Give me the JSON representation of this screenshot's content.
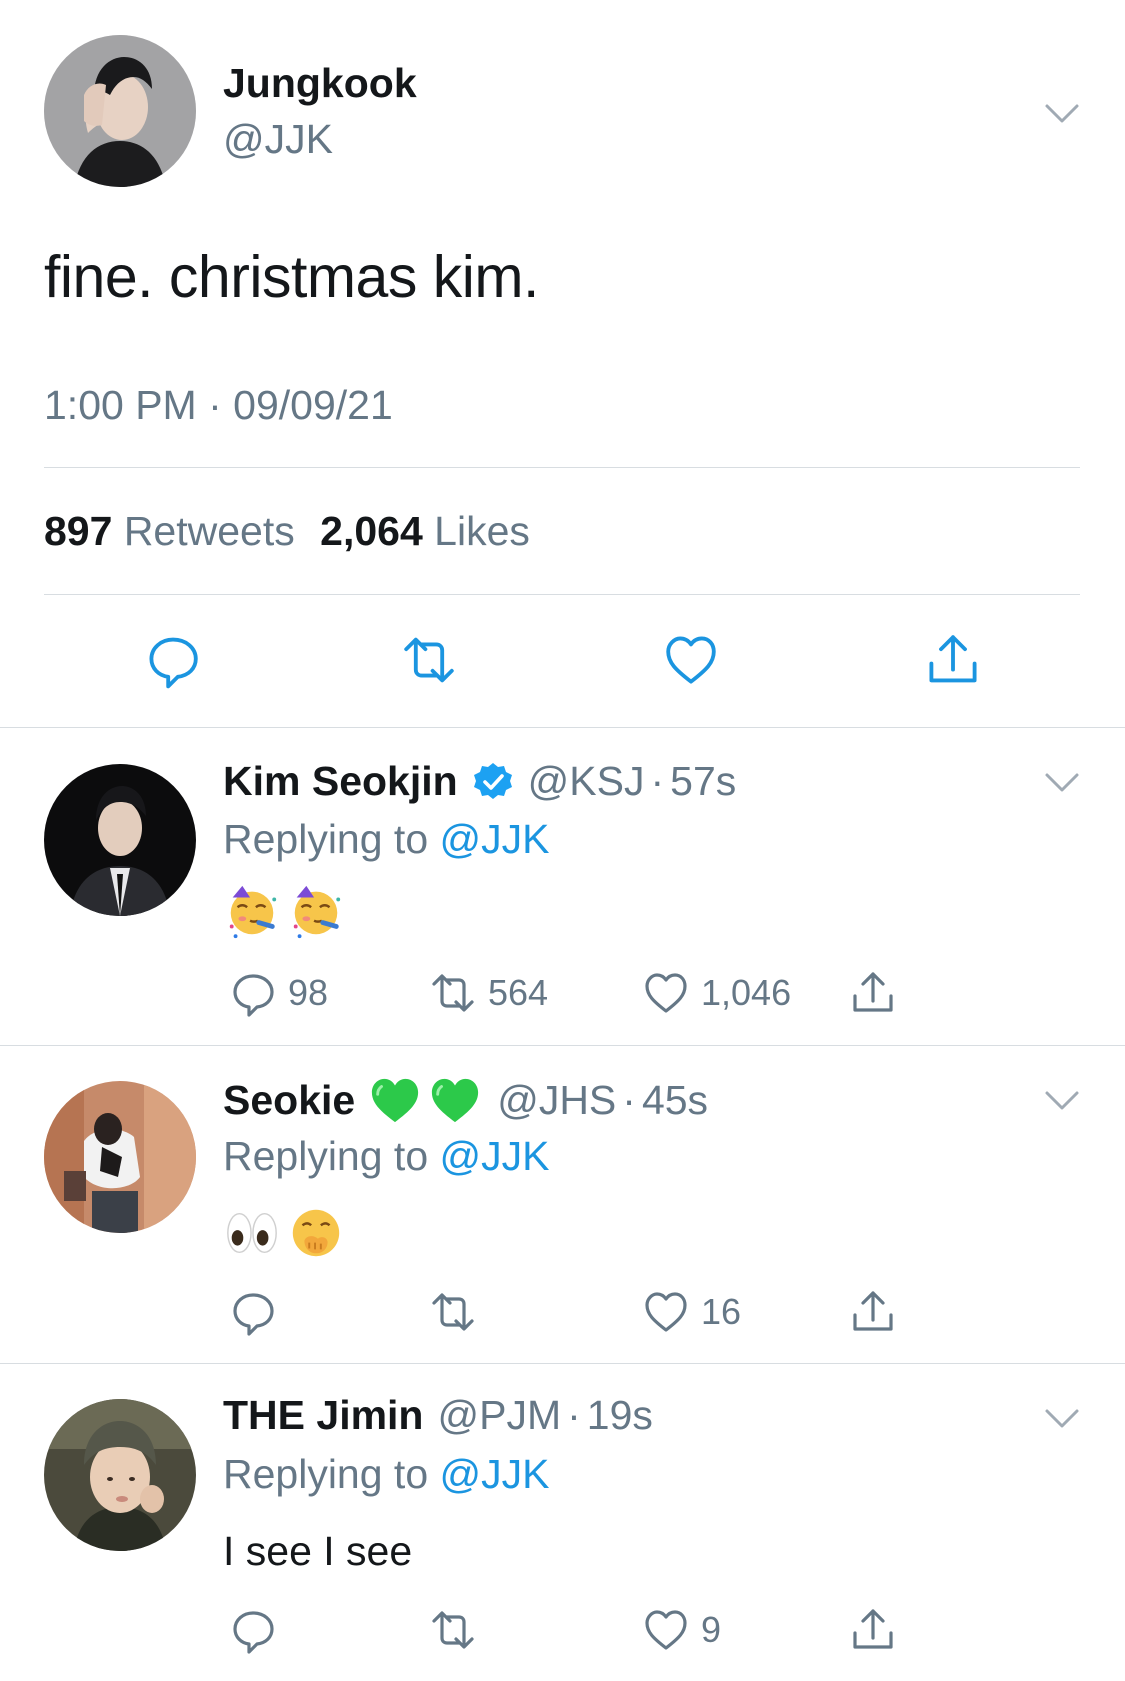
{
  "main_tweet": {
    "author_name": "Jungkook",
    "author_handle": "@JJK",
    "text": "fine. christmas kim.",
    "time": "1:00 PM",
    "separator": "·",
    "date": "09/09/21",
    "retweet_count": "897",
    "retweet_label": "Retweets",
    "like_count": "2,064",
    "like_label": "Likes",
    "actions": [
      "reply-icon",
      "retweet-icon",
      "like-icon",
      "share-icon"
    ]
  },
  "replies": [
    {
      "name": "Kim Seokjin",
      "verified": true,
      "handle": "@KSJ",
      "dot": "·",
      "time": "57s",
      "replying_prefix": "Replying to",
      "replying_handle": "@JJK",
      "emojis": [
        "partying-face-emoji",
        "partying-face-emoji"
      ],
      "reply_count": "98",
      "retweet_count": "564",
      "like_count": "1,046"
    },
    {
      "name": "Seokie",
      "name_emojis": [
        "green-heart-emoji",
        "green-heart-emoji"
      ],
      "handle": "@JHS",
      "dot": "·",
      "time": "45s",
      "replying_prefix": "Replying to",
      "replying_handle": "@JJK",
      "emojis": [
        "eyes-emoji",
        "face-with-hand-over-mouth-emoji"
      ],
      "reply_count": "",
      "retweet_count": "",
      "like_count": "16"
    },
    {
      "name": "THE Jimin",
      "handle": "@PJM",
      "dot": "·",
      "time": "19s",
      "replying_prefix": "Replying to",
      "replying_handle": "@JJK",
      "text": "I see I see",
      "reply_count": "",
      "retweet_count": "",
      "like_count": "9"
    }
  ],
  "colors": {
    "text_primary": "#14171a",
    "text_secondary": "#657786",
    "link": "#1b95e0",
    "divider": "#d8dde1",
    "icon": "#657786",
    "main_icon": "#1b95e0",
    "verified": "#1da1f2"
  }
}
